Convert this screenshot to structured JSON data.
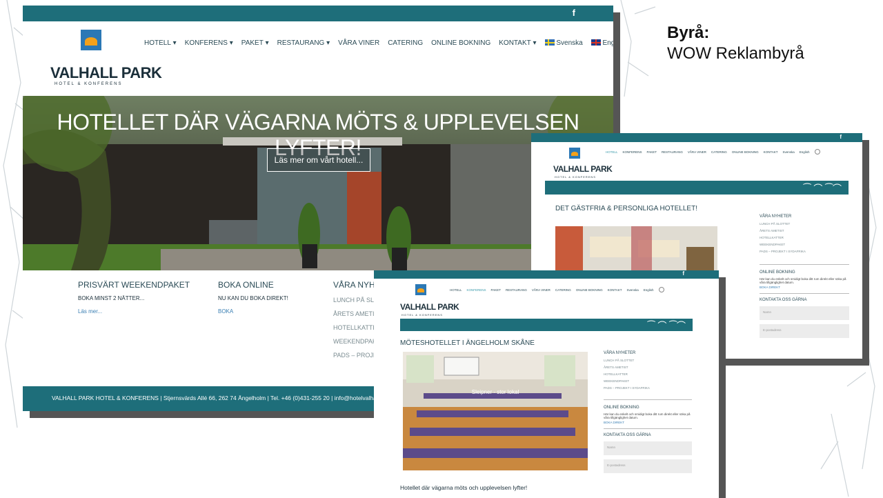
{
  "agency": {
    "label": "Byrå:",
    "name": "WOW Reklambyrå"
  },
  "brand": {
    "name": "VALHALL PARK",
    "tagline": "HOTEL & KONFERENS"
  },
  "social": {
    "facebook": "f"
  },
  "nav": [
    {
      "label": "HOTELL",
      "dropdown": true
    },
    {
      "label": "KONFERENS",
      "dropdown": true
    },
    {
      "label": "PAKET",
      "dropdown": true
    },
    {
      "label": "RESTAURANG",
      "dropdown": true
    },
    {
      "label": "VÅRA VINER",
      "dropdown": false
    },
    {
      "label": "CATERING",
      "dropdown": false
    },
    {
      "label": "ONLINE BOKNING",
      "dropdown": false
    },
    {
      "label": "KONTAKT",
      "dropdown": true
    },
    {
      "label": "Svenska",
      "dropdown": false
    },
    {
      "label": "English",
      "dropdown": false
    }
  ],
  "hero": {
    "headline": "HOTELLET DÄR VÄGARNA MÖTS & UPPLEVELSEN LYFTER!",
    "button": "Läs mer om vårt hotell..."
  },
  "promos": [
    {
      "title": "PRISVÄRT WEEKENDPAKET",
      "subtitle": "BOKA MINST 2 NÄTTER...",
      "link": "Läs mer..."
    },
    {
      "title": "BOKA ONLINE",
      "subtitle": "NU KAN DU BOKA DIREKT!",
      "link": "BOKA"
    }
  ],
  "news": {
    "title": "VÅRA NYHETER",
    "items": [
      "LUNCH PÅ SLOTTET",
      "ÅRETS AMETIST",
      "HOTELLKATTER",
      "WEEKENDPAKET",
      "PADS – PROJEKT I SYDAFRIKA"
    ]
  },
  "footer": {
    "text": "VALHALL PARK HOTEL & KONFERENS | Stjernsvärds Allé 66, 262 74 Ängelholm | Tel. +46 (0)431-255 20 | info@hotelvalhallpark.se | C"
  },
  "page2": {
    "heading": "DET GÄSTFRIA & PERSONLIGA HOTELLET!",
    "online_title": "ONLINE BOKNING",
    "online_text": "Här kan du enkelt och smidigt boka ditt rum direkt eller söka på våra tillgänglighet datum.",
    "online_link": "BOKA DIREKT",
    "contact_title": "KONTAKTA OSS GÄRNA",
    "field_name": "Namn",
    "field_email": "E-postadress"
  },
  "page3": {
    "heading": "MÖTESHOTELLET I ÄNGELHOLM SKÅNE",
    "caption": "Sleipner - stor lokal",
    "body_heading": "Hotellet där vägarna möts och upplevelsen lyfter!"
  },
  "colors": {
    "teal": "#1e6e7a",
    "orange": "#f4a11a",
    "blue": "#2b78b5",
    "link": "#3a7fb3"
  }
}
